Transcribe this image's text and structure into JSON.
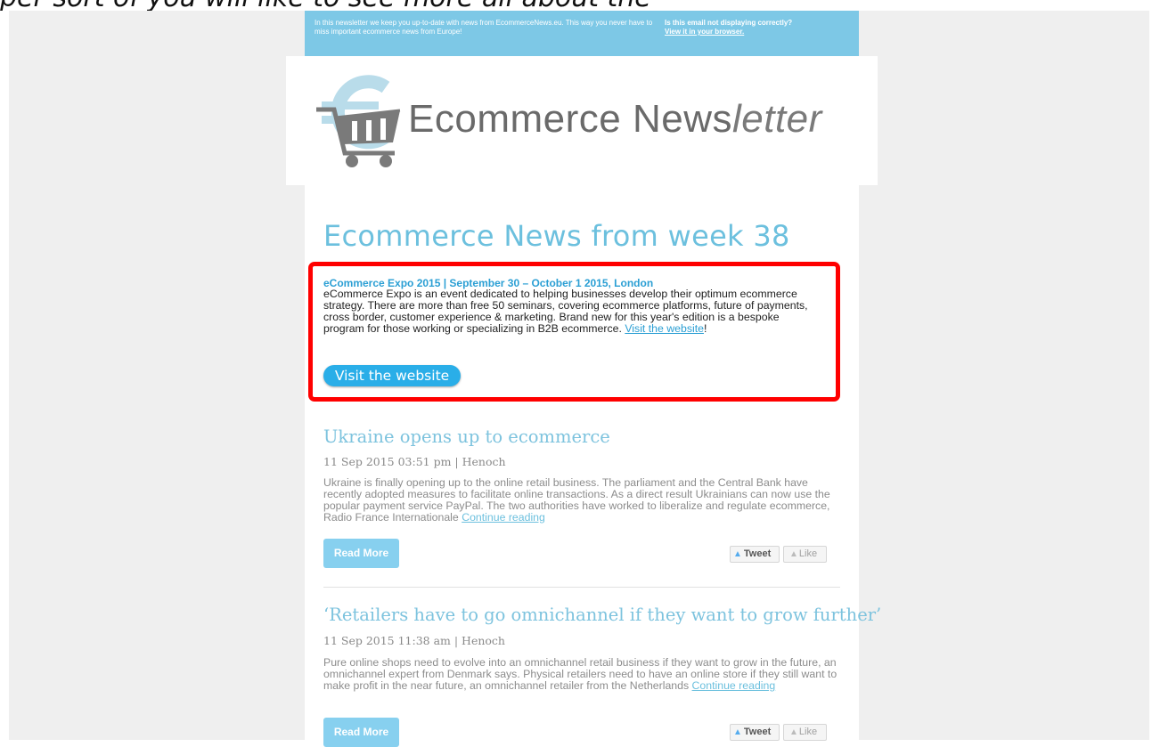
{
  "caption_fragment": "per sort of you will like to see more all about the",
  "preheader": {
    "intro": "In this newsletter we keep you up-to-date with news from EcommerceNews.eu. This way you never have to miss important ecommerce news from Europe!",
    "display_question": "Is this email not displaying correctly?",
    "view_link": "View it in your browser."
  },
  "logo": {
    "word1": "Ecommerce News",
    "word2": "letter"
  },
  "newsletter": {
    "title": "Ecommerce News from week 38"
  },
  "featured": {
    "title": "eCommerce Expo 2015 | September 30 – October 1 2015, London",
    "body": "eCommerce Expo is an event dedicated to helping businesses develop their optimum ecommerce strategy. There are more than free 50 seminars, covering ecommerce platforms, future of payments, cross border, customer experience & marketing. Brand new for this year's edition is a bespoke program for those working or specializing in B2B ecommerce.",
    "link_text": "Visit the website",
    "suffix": "!",
    "button": "Visit the website"
  },
  "articles": [
    {
      "title": "Ukraine opens up to ecommerce",
      "meta": "11 Sep 2015 03:51 pm | Henoch",
      "body": "Ukraine is finally opening up to the online retail business. The parliament and the Central Bank have recently adopted measures to facilitate online transactions. As a direct result Ukrainians can now use the popular payment service PayPal. The two authorities have worked to liberalize and regulate ecommerce, Radio France Internationale",
      "continue": "Continue reading",
      "read_more": "Read More",
      "tweet": "Tweet",
      "like": "Like"
    },
    {
      "title": "‘Retailers have to go omnichannel if they want to grow further’",
      "meta": "11 Sep 2015 11:38 am | Henoch",
      "body": "Pure online shops need to evolve into an omnichannel retail business if they want to grow in the future, an omnichannel expert from Denmark says. Physical retailers need to have an online store if they still want to make profit in the near future, an omnichannel retailer from the Netherlands",
      "continue": "Continue reading",
      "read_more": "Read More",
      "tweet": "Tweet",
      "like": "Like"
    }
  ],
  "colors": {
    "accent": "#6cc0de",
    "preheader_bg": "#7dc8e6",
    "highlight_border": "#ff0000",
    "button_blue": "#2aaee8"
  }
}
